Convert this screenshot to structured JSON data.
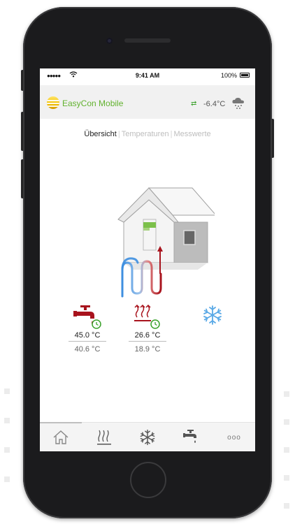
{
  "statusbar": {
    "signal": "●●●●●",
    "time": "9:41 AM",
    "battery": "100%"
  },
  "app": {
    "title": "EasyCon Mobile",
    "outdoor_temp": "-6.4°C",
    "sync_icon": "sync-arrows-icon",
    "weather_icon": "cloud-snow-icon"
  },
  "tabs": [
    {
      "label": "Übersicht",
      "active": true
    },
    {
      "label": "Temperaturen",
      "active": false
    },
    {
      "label": "Messwerte",
      "active": false
    }
  ],
  "status": {
    "hot_water": {
      "current": "45.0 °C",
      "target": "40.6 °C",
      "icon": "faucet-icon"
    },
    "heating": {
      "current": "26.6 °C",
      "target": "18.9 °C",
      "icon": "heating-icon"
    },
    "cooling": {
      "icon": "snowflake-icon"
    }
  },
  "nav": {
    "items": [
      "home-icon",
      "heating-icon",
      "snowflake-icon",
      "faucet-icon"
    ],
    "more": "ooo"
  },
  "colors": {
    "brand_green": "#62b22f",
    "hot_red": "#a8131d",
    "cold_blue": "#5aa9e6",
    "heat_pump_green": "#7cc04a"
  }
}
